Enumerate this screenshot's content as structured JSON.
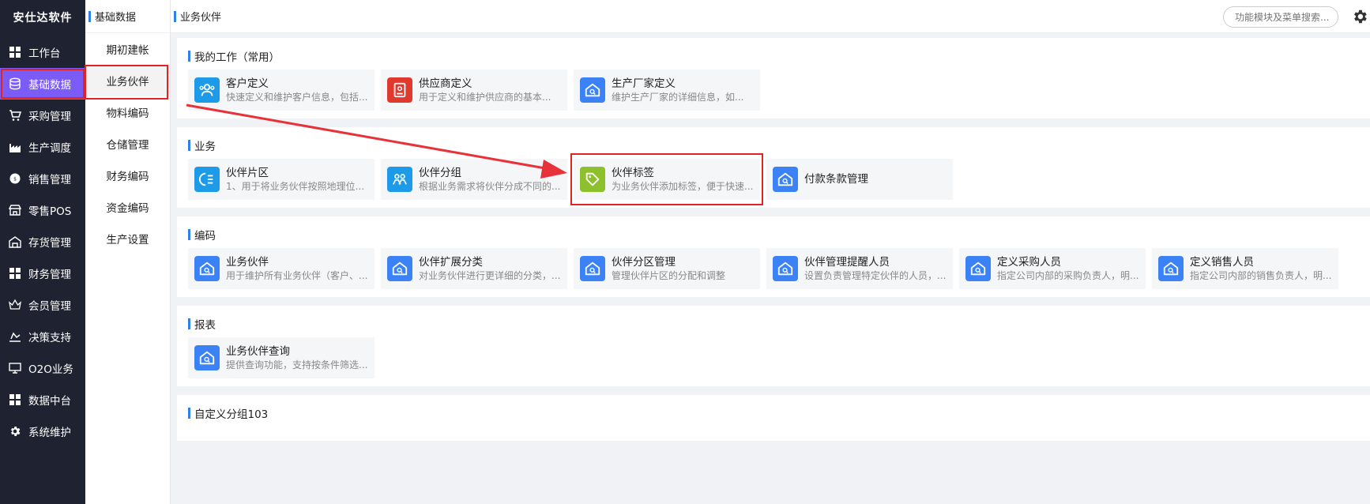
{
  "brand": "安仕达软件",
  "sidebar": {
    "items": [
      {
        "label": "工作台",
        "icon": "grid-icon"
      },
      {
        "label": "基础数据",
        "icon": "database-icon"
      },
      {
        "label": "采购管理",
        "icon": "cart-icon"
      },
      {
        "label": "生产调度",
        "icon": "factory-icon"
      },
      {
        "label": "销售管理",
        "icon": "sales-icon"
      },
      {
        "label": "零售POS",
        "icon": "store-icon"
      },
      {
        "label": "存货管理",
        "icon": "warehouse-icon"
      },
      {
        "label": "财务管理",
        "icon": "grid-icon"
      },
      {
        "label": "会员管理",
        "icon": "crown-icon"
      },
      {
        "label": "决策支持",
        "icon": "chart-icon"
      },
      {
        "label": "O2O业务",
        "icon": "monitor-icon"
      },
      {
        "label": "数据中台",
        "icon": "grid-icon"
      },
      {
        "label": "系统维护",
        "icon": "gear-icon"
      }
    ]
  },
  "submenu": {
    "title": "基础数据",
    "items": [
      "期初建帐",
      "业务伙伴",
      "物料编码",
      "仓储管理",
      "财务编码",
      "资金编码",
      "生产设置"
    ]
  },
  "header": {
    "breadcrumb": "业务伙伴",
    "search_placeholder": "功能模块及菜单搜索..."
  },
  "sections": [
    {
      "title": "我的工作（常用）",
      "cards": [
        {
          "name": "客户定义",
          "desc": "快速定义和维护客户信息，包括...",
          "icon": "customers-icon",
          "color": "#1e9be8"
        },
        {
          "name": "供应商定义",
          "desc": "用于定义和维护供应商的基本...",
          "icon": "supplier-icon",
          "color": "#e03a2f"
        },
        {
          "name": "生产厂家定义",
          "desc": "维护生产厂家的详细信息，如...",
          "icon": "house-search-icon",
          "color": "#3b82f6"
        }
      ]
    },
    {
      "title": "业务",
      "cards": [
        {
          "name": "伙伴片区",
          "desc": "1、用于将业务伙伴按照地理位...",
          "icon": "region-icon",
          "color": "#1e9be8"
        },
        {
          "name": "伙伴分组",
          "desc": "根据业务需求将伙伴分成不同的...",
          "icon": "group-icon",
          "color": "#1e9be8"
        },
        {
          "name": "伙伴标签",
          "desc": "为业务伙伴添加标签，便于快速...",
          "icon": "tag-icon",
          "color": "#8cc02c"
        },
        {
          "name": "付款条款管理",
          "desc": "",
          "icon": "house-search-icon",
          "color": "#3b82f6"
        }
      ]
    },
    {
      "title": "编码",
      "cards": [
        {
          "name": "业务伙伴",
          "desc": "用于维护所有业务伙伴（客户、...",
          "icon": "house-search-icon",
          "color": "#3b82f6"
        },
        {
          "name": "伙伴扩展分类",
          "desc": "对业务伙伴进行更详细的分类，...",
          "icon": "house-search-icon",
          "color": "#3b82f6"
        },
        {
          "name": "伙伴分区管理",
          "desc": "管理伙伴片区的分配和调整",
          "icon": "house-search-icon",
          "color": "#3b82f6"
        },
        {
          "name": "伙伴管理提醒人员",
          "desc": "设置负责管理特定伙伴的人员，...",
          "icon": "house-search-icon",
          "color": "#3b82f6"
        },
        {
          "name": "定义采购人员",
          "desc": "指定公司内部的采购负责人，明...",
          "icon": "house-search-icon",
          "color": "#3b82f6"
        },
        {
          "name": "定义销售人员",
          "desc": "指定公司内部的销售负责人，明...",
          "icon": "house-search-icon",
          "color": "#3b82f6"
        }
      ]
    },
    {
      "title": "报表",
      "cards": [
        {
          "name": "业务伙伴查询",
          "desc": "提供查询功能，支持按条件筛选...",
          "icon": "house-search-icon",
          "color": "#3b82f6"
        }
      ]
    },
    {
      "title": "自定义分组103",
      "cards": []
    }
  ],
  "colors": {
    "sidebar_bg": "#1f2230",
    "active_nav": "#7c5cf6",
    "highlight": "#e02424",
    "accent_bar": "#2f80ed"
  }
}
